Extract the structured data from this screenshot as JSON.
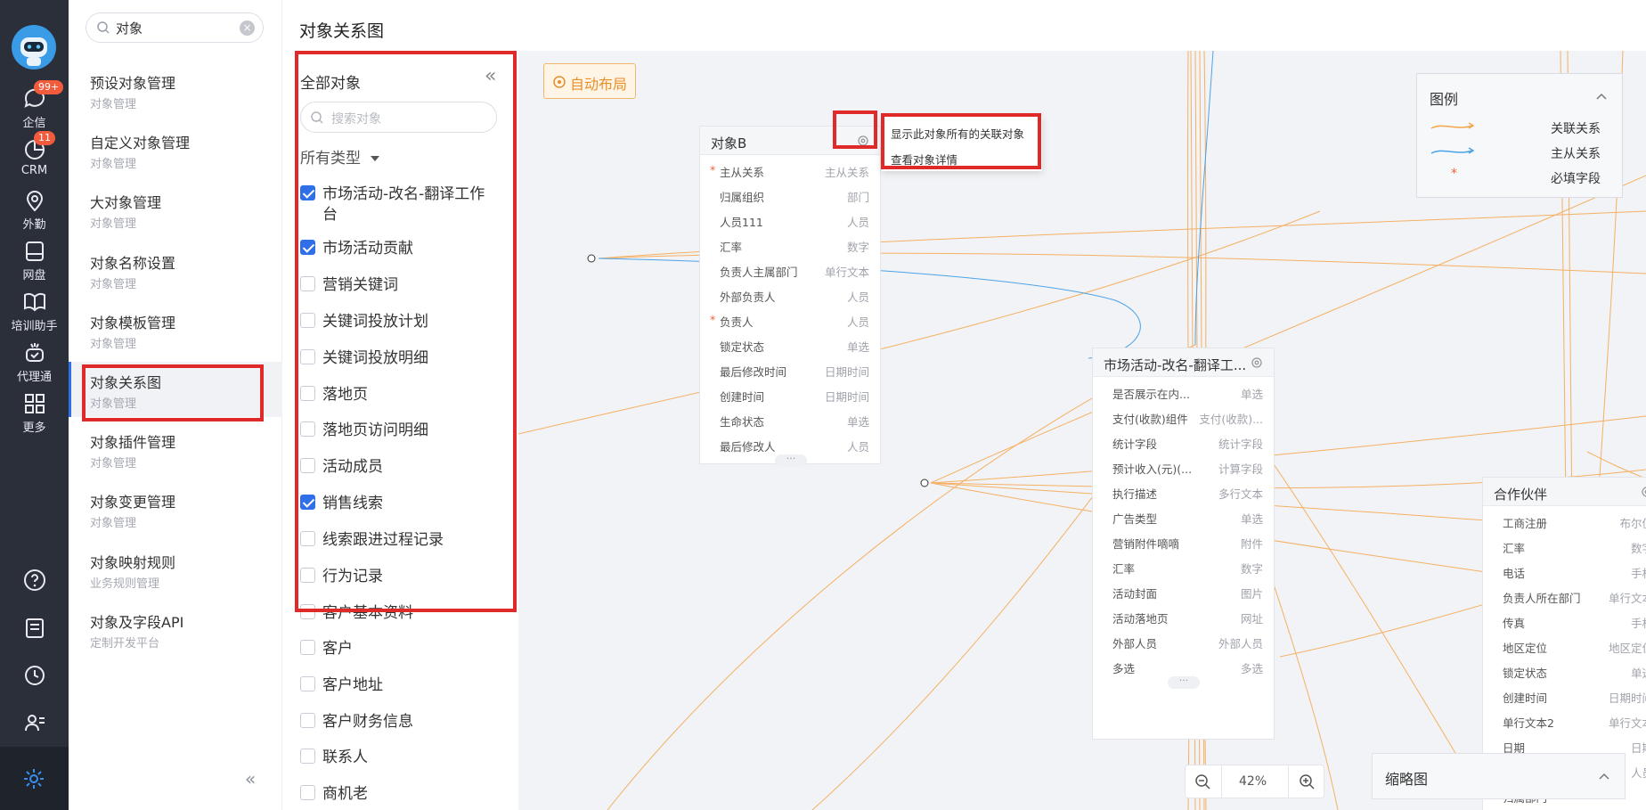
{
  "rail": {
    "items": [
      {
        "label": "企信",
        "badge": "99+"
      },
      {
        "label": "CRM",
        "badge": "11"
      },
      {
        "label": "外勤"
      },
      {
        "label": "网盘"
      },
      {
        "label": "培训助手"
      },
      {
        "label": "代理通"
      },
      {
        "label": "更多"
      }
    ]
  },
  "nav": {
    "search_value": "对象",
    "items": [
      {
        "title": "预设对象管理",
        "sub": "对象管理"
      },
      {
        "title": "自定义对象管理",
        "sub": "对象管理"
      },
      {
        "title": "大对象管理",
        "sub": "对象管理"
      },
      {
        "title": "对象名称设置",
        "sub": "对象管理"
      },
      {
        "title": "对象模板管理",
        "sub": "对象管理"
      },
      {
        "title": "对象关系图",
        "sub": "对象管理"
      },
      {
        "title": "对象插件管理",
        "sub": "对象管理"
      },
      {
        "title": "对象变更管理",
        "sub": "对象管理"
      },
      {
        "title": "对象映射规则",
        "sub": "业务规则管理"
      },
      {
        "title": "对象及字段API",
        "sub": "定制开发平台"
      }
    ],
    "collapse_label": "«"
  },
  "page": {
    "title": "对象关系图"
  },
  "objects_panel": {
    "title": "全部对象",
    "search_placeholder": "搜索对象",
    "type_filter": "所有类型",
    "items": [
      {
        "label": "市场活动-改名-翻译工作",
        "label2": "台",
        "checked": true
      },
      {
        "label": "市场活动贡献",
        "checked": true
      },
      {
        "label": "营销关键词",
        "checked": false
      },
      {
        "label": "关键词投放计划",
        "checked": false
      },
      {
        "label": "关键词投放明细",
        "checked": false
      },
      {
        "label": "落地页",
        "checked": false
      },
      {
        "label": "落地页访问明细",
        "checked": false
      },
      {
        "label": "活动成员",
        "checked": false
      },
      {
        "label": "销售线索",
        "checked": true
      },
      {
        "label": "线索跟进过程记录",
        "checked": false
      },
      {
        "label": "行为记录",
        "checked": false
      },
      {
        "label": "客户基本资料",
        "checked": false
      },
      {
        "label": "客户",
        "checked": false
      },
      {
        "label": "客户地址",
        "checked": false
      },
      {
        "label": "客户财务信息",
        "checked": false
      },
      {
        "label": "联系人",
        "checked": false
      },
      {
        "label": "商机老",
        "checked": false
      }
    ]
  },
  "canvas": {
    "auto_layout_label": "自动布局",
    "context_menu": [
      "显示此对象所有的关联对象",
      "查看对象详情"
    ],
    "cards": [
      {
        "title": "对象B",
        "fields": [
          {
            "name": "主从关系",
            "type": "主从关系",
            "required": true
          },
          {
            "name": "归属组织",
            "type": "部门"
          },
          {
            "name": "人员111",
            "type": "人员"
          },
          {
            "name": "汇率",
            "type": "数字"
          },
          {
            "name": "负责人主属部门",
            "type": "单行文本"
          },
          {
            "name": "外部负责人",
            "type": "人员"
          },
          {
            "name": "负责人",
            "type": "人员",
            "required": true
          },
          {
            "name": "锁定状态",
            "type": "单选"
          },
          {
            "name": "最后修改时间",
            "type": "日期时间"
          },
          {
            "name": "创建时间",
            "type": "日期时间"
          },
          {
            "name": "生命状态",
            "type": "单选"
          },
          {
            "name": "最后修改人",
            "type": "人员"
          }
        ]
      },
      {
        "title": "市场活动-改名-翻译工...",
        "fields": [
          {
            "name": "是否展示在内...",
            "type": "单选"
          },
          {
            "name": "支付(收款)组件",
            "type": "支付(收款)..."
          },
          {
            "name": "统计字段",
            "type": "统计字段"
          },
          {
            "name": "预计收入(元)(...",
            "type": "计算字段"
          },
          {
            "name": "执行描述",
            "type": "多行文本"
          },
          {
            "name": "广告类型",
            "type": "单选"
          },
          {
            "name": "营销附件嘀嘀",
            "type": "附件"
          },
          {
            "name": "汇率",
            "type": "数字"
          },
          {
            "name": "活动封面",
            "type": "图片"
          },
          {
            "name": "活动落地页",
            "type": "网址"
          },
          {
            "name": "外部人员",
            "type": "外部人员"
          },
          {
            "name": "多选",
            "type": "多选"
          }
        ]
      },
      {
        "title": "合作伙伴",
        "fields": [
          {
            "name": "工商注册",
            "type": "布尔值"
          },
          {
            "name": "汇率",
            "type": "数字"
          },
          {
            "name": "电话",
            "type": "手机"
          },
          {
            "name": "负责人所在部门",
            "type": "单行文本"
          },
          {
            "name": "传真",
            "type": "手机"
          },
          {
            "name": "地区定位",
            "type": "地区定位"
          },
          {
            "name": "锁定状态",
            "type": "单选"
          },
          {
            "name": "创建时间",
            "type": "日期时间"
          },
          {
            "name": "单行文本2",
            "type": "单行文本"
          },
          {
            "name": "日期",
            "type": "日期"
          },
          {
            "name": "",
            "type": "人员"
          },
          {
            "name": "归属部门",
            "type": ""
          }
        ]
      }
    ],
    "legend": {
      "title": "图例",
      "items": [
        {
          "label": "关联关系",
          "color": "#f5a54a"
        },
        {
          "label": "主从关系",
          "color": "#4aa3e8"
        },
        {
          "label": "必填字段",
          "color": "#f25c3c"
        }
      ]
    },
    "zoom": "42%",
    "minimap_label": "缩略图"
  },
  "colors": {
    "accent": "#2f6fe8",
    "highlight": "#e02a2a",
    "relation": "#f5a54a",
    "master": "#4aa3e8"
  }
}
